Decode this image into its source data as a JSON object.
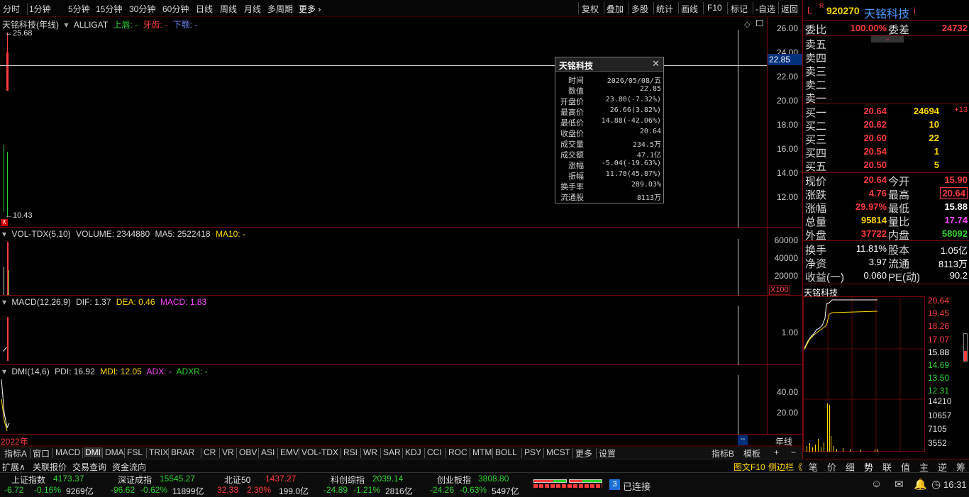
{
  "periods": [
    "分时",
    "1分钟",
    "5分钟",
    "15分钟",
    "30分钟",
    "60分钟",
    "日线",
    "周线",
    "月线",
    "多周期",
    "更多"
  ],
  "active_period": "年线",
  "tools": [
    "复权",
    "叠加",
    "多股",
    "统计",
    "画线",
    "F10",
    "标记",
    "-自选",
    "返回"
  ],
  "chart_title": {
    "stock": "天铭科技(年线)",
    "indicator": "ALLIGAT",
    "up_lip": "上唇: -",
    "teeth": "牙齿: -",
    "jaw": "下颚: -"
  },
  "price_axis": [
    "26.00",
    "24.00",
    "22.00",
    "20.00",
    "18.00",
    "16.00",
    "14.00",
    "12.00"
  ],
  "crosshair_value": "22.85",
  "high_marker": "25.68",
  "low_marker": "10.43",
  "vol_title": {
    "name": "VOL-TDX(5,10)",
    "volume": "VOLUME: 2344880",
    "ma5": "MA5: 2522418",
    "ma10": "MA10: -"
  },
  "vol_axis": [
    "60000",
    "40000",
    "20000"
  ],
  "vol_unit": "X100",
  "macd_title": {
    "name": "MACD(12,26,9)",
    "dif": "DIF: 1.37",
    "dea": "DEA: 0.46",
    "macd": "MACD: 1.83"
  },
  "macd_axis": [
    "1.00"
  ],
  "dmi_title": {
    "name": "DMI(14,6)",
    "pdi": "PDI: 16.92",
    "mdi": "MDI: 12.05",
    "adx": "ADX: -",
    "adxr": "ADXR: -"
  },
  "dmi_axis": [
    "40.00",
    "20.00"
  ],
  "year_label": "2022年",
  "period_label": "年线",
  "cursor_box": "--",
  "tooltip": {
    "title": "天铭科技",
    "rows": [
      {
        "k": "时间",
        "v": "2026/05/08/五",
        "c": "white"
      },
      {
        "k": "数值",
        "v": "22.85",
        "c": "white"
      },
      {
        "k": "开盘价",
        "v": "23.80(-7.32%)",
        "c": "green"
      },
      {
        "k": "最高价",
        "v": "26.66(3.82%)",
        "c": "red"
      },
      {
        "k": "最低价",
        "v": "14.88(-42.06%)",
        "c": "green"
      },
      {
        "k": "收盘价",
        "v": "20.64",
        "c": "green"
      },
      {
        "k": "成交量",
        "v": "234.5万",
        "c": "yellow"
      },
      {
        "k": "成交额",
        "v": "47.1亿",
        "c": "white"
      },
      {
        "k": "涨幅",
        "v": "-5.04(-19.63%)",
        "c": "green"
      },
      {
        "k": "振幅",
        "v": "11.78(45.87%)",
        "c": "white"
      },
      {
        "k": "换手率",
        "v": "289.03%",
        "c": "white"
      },
      {
        "k": "流通股",
        "v": "8113万",
        "c": "white"
      }
    ]
  },
  "indicator_tabs": [
    "指标A",
    "窗口",
    "MACD",
    "DMI",
    "DMA",
    "FSL",
    "TRIX",
    "BRAR",
    "CR",
    "VR",
    "OBV",
    "ASI",
    "EMV",
    "VOL-TDX",
    "RSI",
    "WR",
    "SAR",
    "KDJ",
    "CCI",
    "ROC",
    "MTM",
    "BOLL",
    "PSY",
    "MCST",
    "更多",
    "设置"
  ],
  "active_indicator_tab": "DMI",
  "tabs_right": [
    "指标B",
    "模板",
    "+",
    "−"
  ],
  "bar2_left": [
    "扩展∧",
    "关联报价",
    "交易查询",
    "资金流向"
  ],
  "bar2_mid": [
    "图文F10",
    "侧边栏《"
  ],
  "indices": [
    {
      "name": "上证指数",
      "value": "4173.37",
      "change": "-6.72",
      "pct": "-0.16%",
      "amount": "9269亿",
      "color": "green"
    },
    {
      "name": "深证成指",
      "value": "15545.27",
      "change": "-96.62",
      "pct": "-0.62%",
      "amount": "11899亿",
      "color": "green"
    },
    {
      "name": "北证50",
      "value": "1437.27",
      "change": "32.33",
      "pct": "2.30%",
      "amount": "199.0亿",
      "color": "red"
    },
    {
      "name": "科创综指",
      "value": "2039.14",
      "change": "-24.89",
      "pct": "-1.21%",
      "amount": "2816亿",
      "color": "green"
    },
    {
      "name": "创业板指",
      "value": "3808.80",
      "change": "-24.26",
      "pct": "-0.63%",
      "amount": "5497亿",
      "color": "green"
    }
  ],
  "connection": {
    "count": "3",
    "label": "已连接"
  },
  "clock": "16:31",
  "right_header": {
    "l": "L",
    "r": "R",
    "code": "920270",
    "name": "天铭科技",
    "info": "i"
  },
  "weibi": {
    "label1": "委比",
    "value1": "100.00%",
    "label2": "委差",
    "value2": "24732"
  },
  "sell": [
    {
      "label": "卖五",
      "price": "",
      "vol": ""
    },
    {
      "label": "卖四",
      "price": "",
      "vol": ""
    },
    {
      "label": "卖三",
      "price": "",
      "vol": ""
    },
    {
      "label": "卖二",
      "price": "",
      "vol": ""
    },
    {
      "label": "卖一",
      "price": "",
      "vol": ""
    }
  ],
  "buy": [
    {
      "label": "买一",
      "price": "20.64",
      "vol": "24694",
      "chg": "+13"
    },
    {
      "label": "买二",
      "price": "20.62",
      "vol": "10",
      "chg": ""
    },
    {
      "label": "买三",
      "price": "20.60",
      "vol": "22",
      "chg": ""
    },
    {
      "label": "买四",
      "price": "20.54",
      "vol": "1",
      "chg": ""
    },
    {
      "label": "买五",
      "price": "20.50",
      "vol": "5",
      "chg": ""
    }
  ],
  "quote": [
    {
      "l1": "现价",
      "v1": "20.64",
      "c1": "red",
      "l2": "今开",
      "v2": "15.90",
      "c2": "red"
    },
    {
      "l1": "涨跌",
      "v1": "4.76",
      "c1": "red",
      "l2": "最高",
      "v2": "20.64",
      "c2": "red"
    },
    {
      "l1": "涨幅",
      "v1": "29.97%",
      "c1": "red",
      "l2": "最低",
      "v2": "15.88",
      "c2": "white"
    },
    {
      "l1": "总量",
      "v1": "95814",
      "c1": "yellow",
      "l2": "量比",
      "v2": "17.74",
      "c2": "magenta"
    },
    {
      "l1": "外盘",
      "v1": "37722",
      "c1": "red",
      "l2": "内盘",
      "v2": "58092",
      "c2": "green"
    }
  ],
  "fundamentals": [
    {
      "l1": "换手",
      "v1": "11.81%",
      "l2": "股本",
      "v2": "1.05亿"
    },
    {
      "l1": "净资",
      "v1": "3.97",
      "l2": "流通",
      "v2": "8113万"
    },
    {
      "l1": "收益(一)",
      "v1": "0.060",
      "l2": "PE(动)",
      "v2": "90.2"
    }
  ],
  "mini_chart": {
    "title": "天铭科技",
    "price_ticks": [
      {
        "v": "20.64",
        "c": "red"
      },
      {
        "v": "19.45",
        "c": "red"
      },
      {
        "v": "18.26",
        "c": "red"
      },
      {
        "v": "17.07",
        "c": "red"
      },
      {
        "v": "15.88",
        "c": "white"
      },
      {
        "v": "14.69",
        "c": "green"
      },
      {
        "v": "13.50",
        "c": "green"
      },
      {
        "v": "12.31",
        "c": "green"
      }
    ],
    "vol_ticks": [
      "14210",
      "10657",
      "7105",
      "3552"
    ]
  },
  "right_tabs": [
    "笔",
    "价",
    "细",
    "势",
    "联",
    "值",
    "主",
    "逆",
    "筹"
  ],
  "active_right_tab": "势"
}
